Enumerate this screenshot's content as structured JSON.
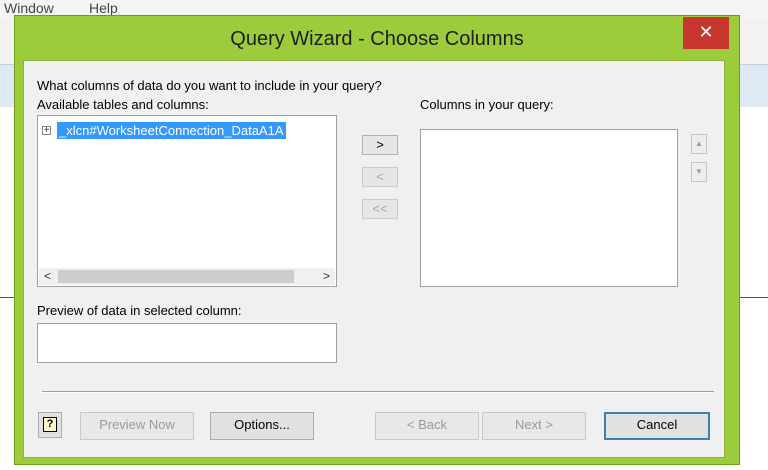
{
  "background_app": {
    "menu": [
      "Window",
      "Help"
    ]
  },
  "dialog": {
    "title": "Query Wizard - Choose Columns",
    "close_glyph": "✕",
    "prompt": "What columns of data do you want to include in your query?",
    "available_label": "Available tables and columns:",
    "tree_items": [
      {
        "expander": "+",
        "label": "_xlcn#WorksheetConnection_DataA1A",
        "selected": true
      }
    ],
    "scroll_left": "<",
    "scroll_right": ">",
    "move_buttons": {
      "add": ">",
      "remove": "<",
      "remove_all": "<<"
    },
    "columns_label": "Columns in your query:",
    "reorder": {
      "up": "▲",
      "down": "▼"
    },
    "preview_label": "Preview of data in selected column:",
    "buttons": {
      "help": "?",
      "preview_now": "Preview Now",
      "options": "Options...",
      "back": "< Back",
      "next": "Next >",
      "cancel": "Cancel"
    }
  },
  "colors": {
    "frame_accent": "#9ccc3c",
    "close_button": "#c7372f",
    "selection": "#3399ff"
  }
}
